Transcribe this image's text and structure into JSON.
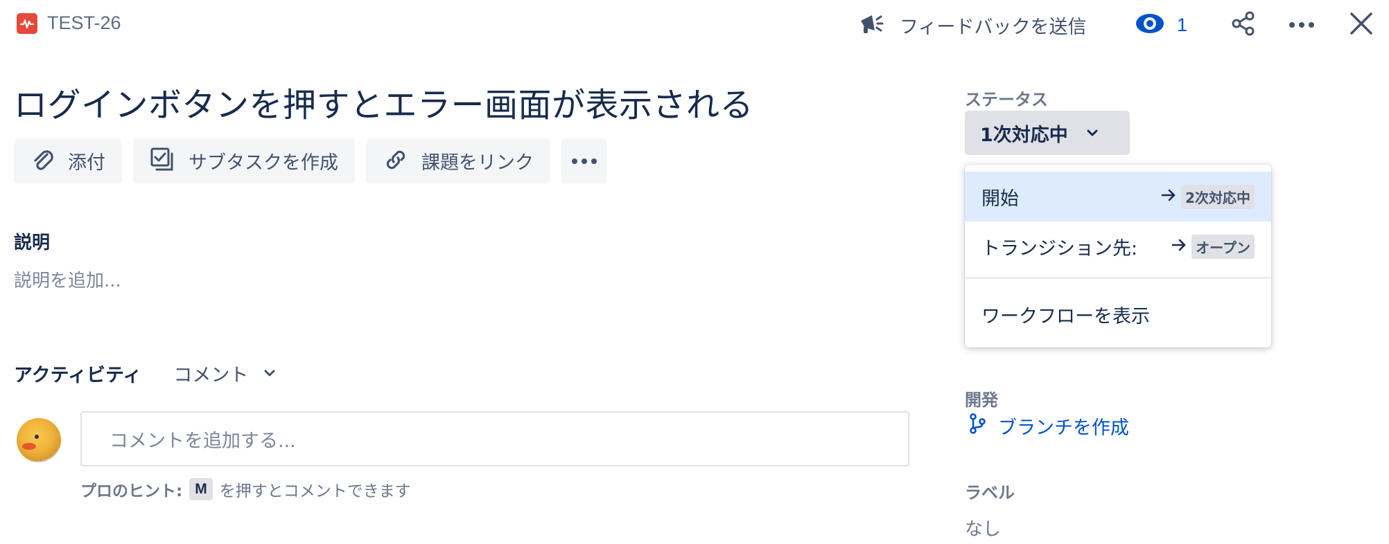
{
  "header": {
    "issue_key": "TEST-26",
    "feedback_label": "フィードバックを送信",
    "watch_count": "1"
  },
  "issue": {
    "title": "ログインボタンを押すとエラー画面が表示される"
  },
  "actions": {
    "attach": "添付",
    "create_subtask": "サブタスクを作成",
    "link_issue": "課題をリンク"
  },
  "description": {
    "heading": "説明",
    "placeholder": "説明を追加..."
  },
  "activity": {
    "heading": "アクティビティ",
    "filter": "コメント",
    "comment_placeholder": "コメントを追加する...",
    "hint_prefix": "プロのヒント:",
    "hint_key": "M",
    "hint_suffix": "を押すとコメントできます"
  },
  "sidebar": {
    "status_label": "ステータス",
    "status_value": "1次対応中",
    "menu": {
      "items": [
        {
          "label": "開始",
          "target": "2次対応中"
        },
        {
          "label": "トランジション先:",
          "target": "オープン"
        }
      ],
      "view_workflow": "ワークフローを表示"
    },
    "development_label": "開発",
    "create_branch": "ブランチを作成",
    "labels_label": "ラベル",
    "labels_value": "なし"
  },
  "colors": {
    "accent": "#0052cc",
    "issue_type_bug": "#e5493a",
    "menu_active": "#deebff"
  }
}
